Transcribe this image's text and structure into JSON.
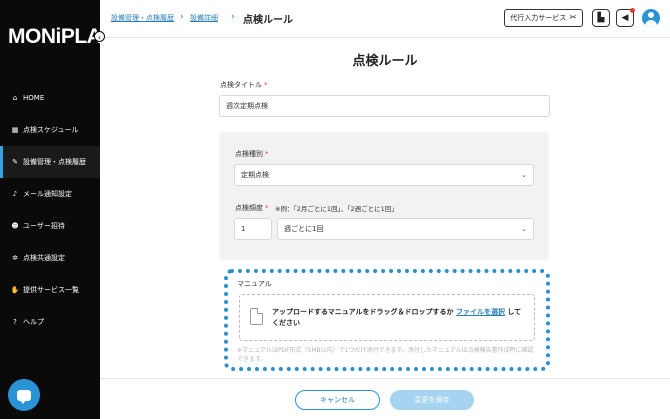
{
  "sidebar": {
    "logo": "MONiPLAT",
    "collapse_icon": "chevron-left-icon",
    "items": [
      {
        "icon": "home-icon",
        "glyph": "⌂",
        "label": "HOME",
        "active": false
      },
      {
        "icon": "calendar-icon",
        "glyph": "▦",
        "label": "点検スケジュール",
        "active": false
      },
      {
        "icon": "wrench-icon",
        "glyph": "✎",
        "label": "設備管理・点検履歴",
        "active": true
      },
      {
        "icon": "bell-icon",
        "glyph": "♪",
        "label": "メール通知設定",
        "active": false
      },
      {
        "icon": "user-plus-icon",
        "glyph": "☻",
        "label": "ユーザー招待",
        "active": false
      },
      {
        "icon": "gear-icon",
        "glyph": "✲",
        "label": "点検共通設定",
        "active": false
      },
      {
        "icon": "handshake-icon",
        "glyph": "✋",
        "label": "提供サービス一覧",
        "active": false
      },
      {
        "icon": "help-icon",
        "glyph": "?",
        "label": "ヘルプ",
        "active": false
      }
    ],
    "chat_icon": "chat-icon"
  },
  "header": {
    "breadcrumb": [
      "設備管理・点検履歴",
      "設備詳細"
    ],
    "current": "点検ルール",
    "proxy_button": "代行入力サービス",
    "proxy_icon": "tools-icon"
  },
  "form": {
    "title": "点検ルール",
    "inspection_title_label": "点検タイトル",
    "inspection_title_value": "週次定期点検",
    "type_label": "点検種別",
    "type_value": "定期点検",
    "frequency_label": "点検頻度",
    "frequency_example": "※例：「2月ごとに1回」、「2週ごとに1回」",
    "frequency_number": "1",
    "frequency_unit": "週ごとに1回",
    "required_mark": "*"
  },
  "upload": {
    "label": "マニュアル",
    "text_before": "アップロードするマニュアルをドラッグ＆ドロップするか ",
    "link": "ファイルを選択",
    "text_after": " してください",
    "note": "※マニュアルはPDF形式（5MB以内）で1つだけ添付できます。添付したマニュアルは点検報告書作成時に確認できます。"
  },
  "footer": {
    "cancel": "キャンセル",
    "save": "変更を保存"
  },
  "colors": {
    "accent": "#2a93d5",
    "sidebar_bg": "#0a0a0a",
    "required": "#e53935"
  }
}
